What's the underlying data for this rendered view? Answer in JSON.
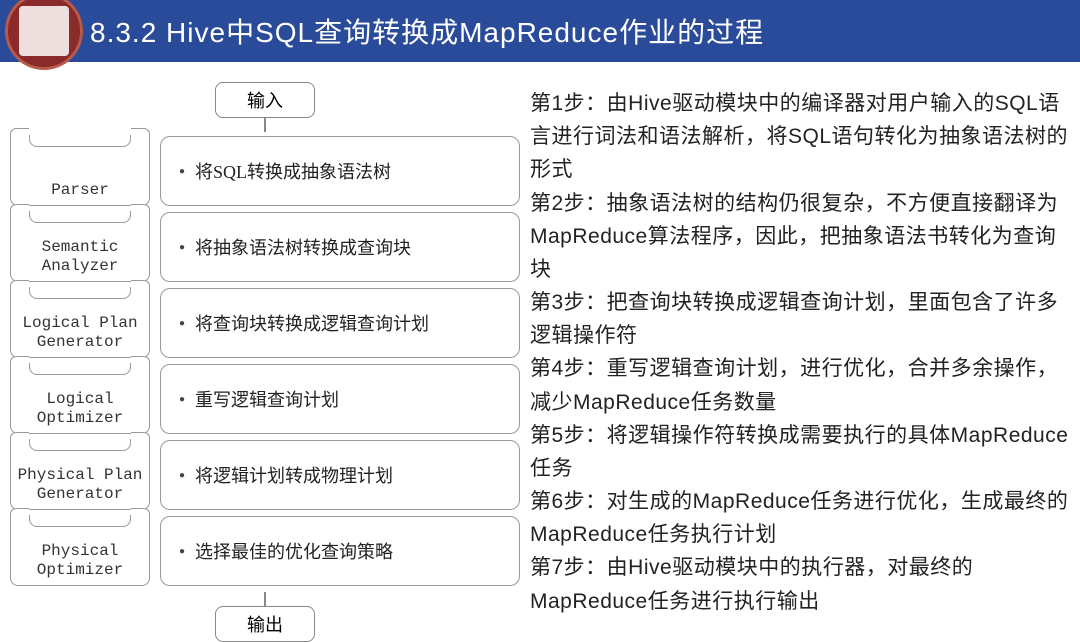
{
  "header": {
    "title": "8.3.2  Hive中SQL查询转换成MapReduce作业的过程"
  },
  "io": {
    "input": "输入",
    "output": "输出"
  },
  "stages": [
    {
      "name": "Parser",
      "desc": "将SQL转换成抽象语法树"
    },
    {
      "name": "Semantic\nAnalyzer",
      "desc": "将抽象语法树转换成查询块"
    },
    {
      "name": "Logical Plan\nGenerator",
      "desc": "将查询块转换成逻辑查询计划"
    },
    {
      "name": "Logical\nOptimizer",
      "desc": "重写逻辑查询计划"
    },
    {
      "name": "Physical Plan\nGenerator",
      "desc": "将逻辑计划转成物理计划"
    },
    {
      "name": "Physical\nOptimizer",
      "desc": "选择最佳的优化查询策略"
    }
  ],
  "steps": [
    "第1步：由Hive驱动模块中的编译器对用户输入的SQL语言进行词法和语法解析，将SQL语句转化为抽象语法树的形式",
    "第2步：抽象语法树的结构仍很复杂，不方便直接翻译为MapReduce算法程序，因此，把抽象语法书转化为查询块",
    "第3步：把查询块转换成逻辑查询计划，里面包含了许多逻辑操作符",
    "第4步：重写逻辑查询计划，进行优化，合并多余操作，减少MapReduce任务数量",
    "第5步：将逻辑操作符转换成需要执行的具体MapReduce任务",
    "第6步：对生成的MapReduce任务进行优化，生成最终的MapReduce任务执行计划",
    "第7步：由Hive驱动模块中的执行器，对最终的MapReduce任务进行执行输出"
  ]
}
